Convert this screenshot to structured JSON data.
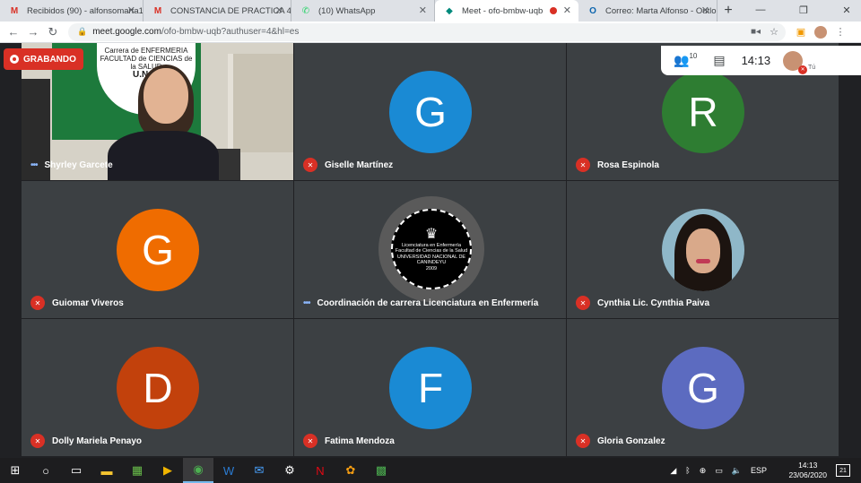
{
  "browser": {
    "tabs": [
      {
        "label": "Recibidos (90) - alfonsomarta1",
        "icon": "gmail-icon",
        "icon_glyph": "M",
        "icon_color": "#d93025"
      },
      {
        "label": "CONSTANCIA DE PRACTICA 4°",
        "icon": "gmail-icon",
        "icon_glyph": "M",
        "icon_color": "#d93025"
      },
      {
        "label": "(10) WhatsApp",
        "icon": "whatsapp-icon",
        "icon_glyph": "✆",
        "icon_color": "#25d366"
      },
      {
        "label": "Meet - ofo-bmbw-uqb",
        "icon": "meet-icon",
        "icon_glyph": "◆",
        "icon_color": "#00897b",
        "active": true
      },
      {
        "label": "Correo: Marta Alfonso - Outlo",
        "icon": "outlook-icon",
        "icon_glyph": "O",
        "icon_color": "#0a64ad"
      }
    ],
    "url_host": "meet.google.com",
    "url_path": "/ofo-bmbw-uqb?authuser=4&hl=es"
  },
  "meet": {
    "recording_label": "GRABANDO",
    "participant_count": "10",
    "clock": "14:13",
    "self_label": "Tú"
  },
  "participants": [
    {
      "name": "Shyrley Garcete",
      "kind": "video",
      "mic": "speaking"
    },
    {
      "name": "Giselle Martínez",
      "kind": "avatar",
      "letter": "G",
      "color": "#1a8ad4",
      "mic": "muted"
    },
    {
      "name": "Rosa Espinola",
      "kind": "avatar",
      "letter": "R",
      "color": "#2e7d32",
      "mic": "muted"
    },
    {
      "name": "Guiomar Viveros",
      "kind": "avatar",
      "letter": "G",
      "color": "#ef6c00",
      "mic": "muted"
    },
    {
      "name": "Coordinación de carrera Licenciatura en Enfermería",
      "kind": "logo",
      "mic": "speaking"
    },
    {
      "name": "Cynthia Lic. Cynthia Paiva",
      "kind": "photo",
      "mic": "muted"
    },
    {
      "name": "Dolly Mariela Penayo",
      "kind": "avatar",
      "letter": "D",
      "color": "#c2410c",
      "mic": "muted"
    },
    {
      "name": "Fatima Mendoza",
      "kind": "avatar",
      "letter": "F",
      "color": "#1a8ad4",
      "mic": "muted"
    },
    {
      "name": "Gloria Gonzalez",
      "kind": "avatar",
      "letter": "G",
      "color": "#5c6bc0",
      "mic": "muted"
    }
  ],
  "video_banner": {
    "line1": "Carrera de ENFERMERIA",
    "line2": "FACULTAD de CIENCIAS de la SALUD",
    "line3": "U.N.C."
  },
  "logo_text": {
    "line1": "Licenciatura en Enfermería",
    "line2": "Facultad de Ciencias de la Salud",
    "line3": "UNIVERSIDAD NACIONAL DE CANINDEYU",
    "line4": "2009"
  },
  "taskbar": {
    "language": "ESP",
    "time": "14:13",
    "date": "23/06/2020",
    "notifications": "21"
  }
}
